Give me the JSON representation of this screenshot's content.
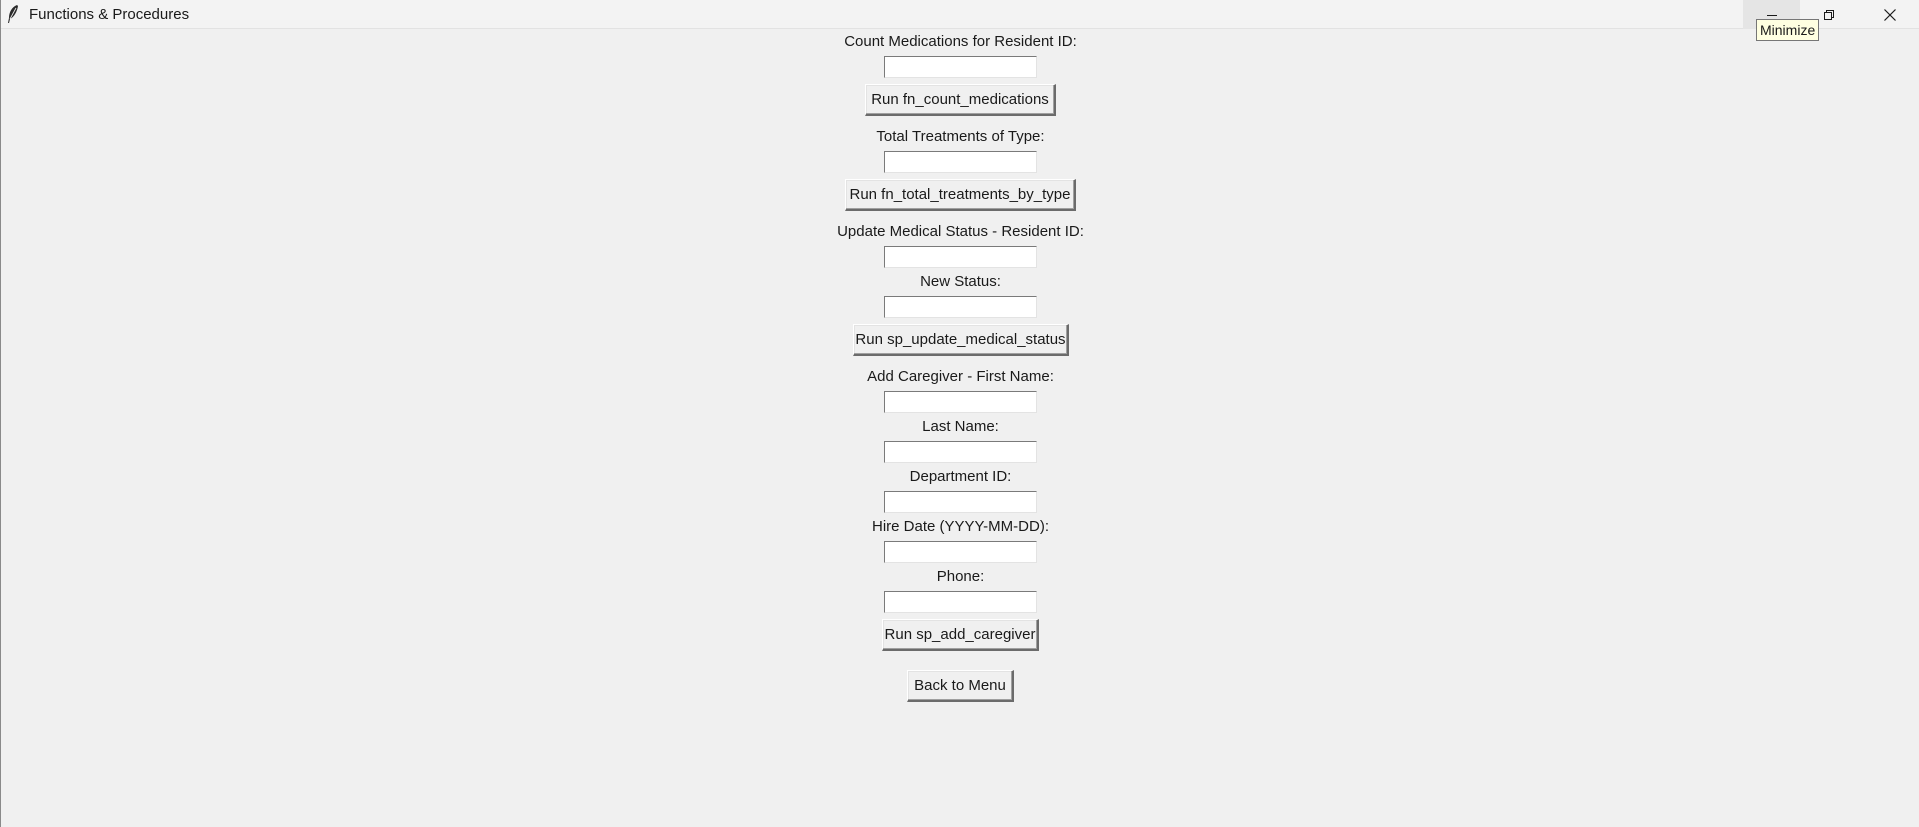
{
  "window": {
    "title": "Functions & Procedures",
    "app_icon": "feather-icon",
    "controls": {
      "minimize_icon": "minimize-icon",
      "maximize_icon": "restore-icon",
      "close_icon": "close-icon"
    },
    "tooltip": "Minimize"
  },
  "form": {
    "count_medications": {
      "label": "Count Medications for Resident ID:",
      "value": "",
      "button": "Run fn_count_medications"
    },
    "total_treatments": {
      "label": "Total Treatments of Type:",
      "value": "",
      "button": "Run fn_total_treatments_by_type"
    },
    "update_status": {
      "resident_label": "Update Medical Status - Resident ID:",
      "resident_value": "",
      "status_label": "New Status:",
      "status_value": "",
      "button": "Run sp_update_medical_status"
    },
    "add_caregiver": {
      "first_name_label": "Add Caregiver - First Name:",
      "first_name_value": "",
      "last_name_label": "Last Name:",
      "last_name_value": "",
      "department_label": "Department ID:",
      "department_value": "",
      "hire_date_label": "Hire Date (YYYY-MM-DD):",
      "hire_date_value": "",
      "phone_label": "Phone:",
      "phone_value": "",
      "button": "Run sp_add_caregiver"
    },
    "back_button": "Back to Menu"
  },
  "colors": {
    "background": "#f0f0f0",
    "entry_background": "#ffffff",
    "tooltip_background": "#ffffe1"
  }
}
